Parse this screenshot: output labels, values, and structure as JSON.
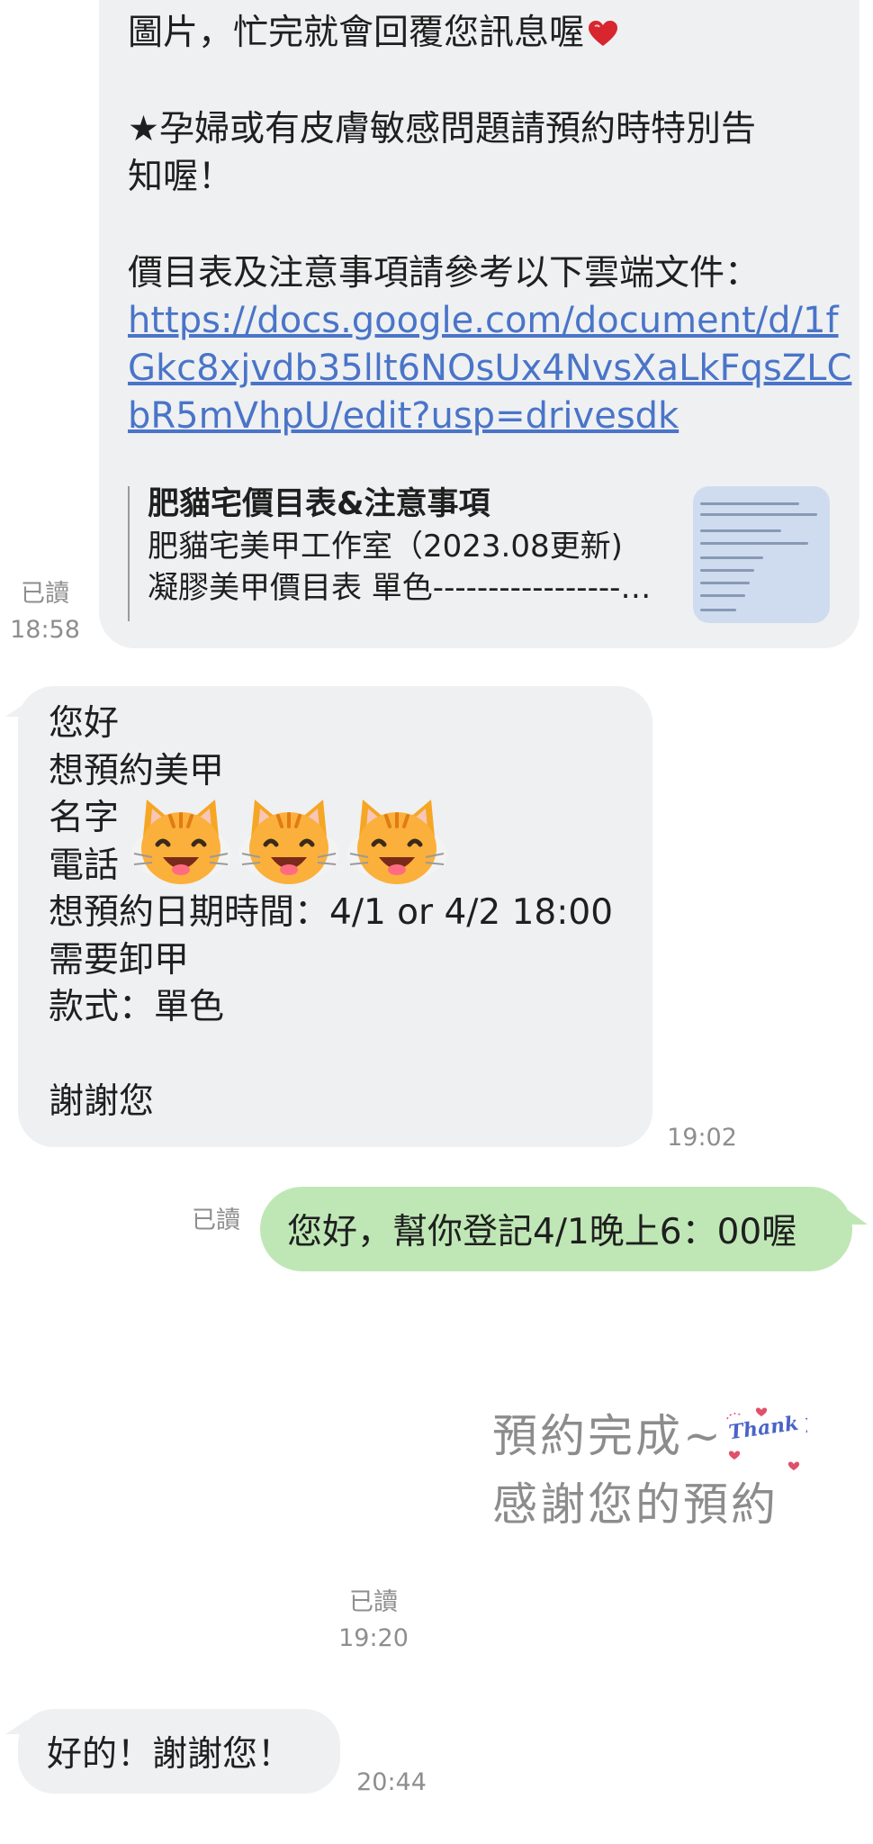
{
  "messages": [
    {
      "direction": "outgoing",
      "lines": [
        "圖片，忙完就會回覆您訊息喔",
        "",
        "★孕婦或有皮膚敏感問題請預約時特別告",
        "知喔！",
        "",
        "價目表及注意事項請參考以下雲端文件："
      ],
      "link_lines": [
        "https://docs.google.com/document/d/1f",
        "Gkc8xjvdb35llt6NOsUx4NvsXaLkFqsZLC",
        "bR5mVhpU/edit?usp=drivesdk"
      ],
      "preview": {
        "title": "肥貓宅價目表&注意事項",
        "description_1": "肥貓宅美甲工作室（2023.08更新)",
        "description_2": "凝膠美甲價目表 單色-----------------------..."
      },
      "read_label": "已讀",
      "time": "18:58"
    },
    {
      "direction": "incoming",
      "lines": [
        "您好",
        "想預約美甲",
        "名字",
        "電話",
        "想預約日期時間：4/1 or 4/2 18:00",
        "需要卸甲",
        "款式：單色",
        "",
        "謝謝您"
      ],
      "stickers": [
        "cat-face-icon",
        "cat-face-icon",
        "cat-face-icon"
      ],
      "time": "19:02"
    },
    {
      "direction": "outgoing",
      "text": "您好，幫你登記4/1晚上6：00喔",
      "read_label": "已讀"
    },
    {
      "direction": "outgoing",
      "type": "sticker",
      "sticker_line_1": "預約完成~",
      "sticker_line_2": "感謝您的預約",
      "sticker_badge": "Thank you!!",
      "read_label": "已讀",
      "time": "19:20"
    },
    {
      "direction": "incoming",
      "text": "好的！謝謝您！",
      "time": "20:44"
    }
  ],
  "colors": {
    "grey_bubble": "#eef0f2",
    "green_bubble": "#bfe7b5",
    "link": "#4a74c8",
    "meta_text": "#8e8e8e"
  }
}
